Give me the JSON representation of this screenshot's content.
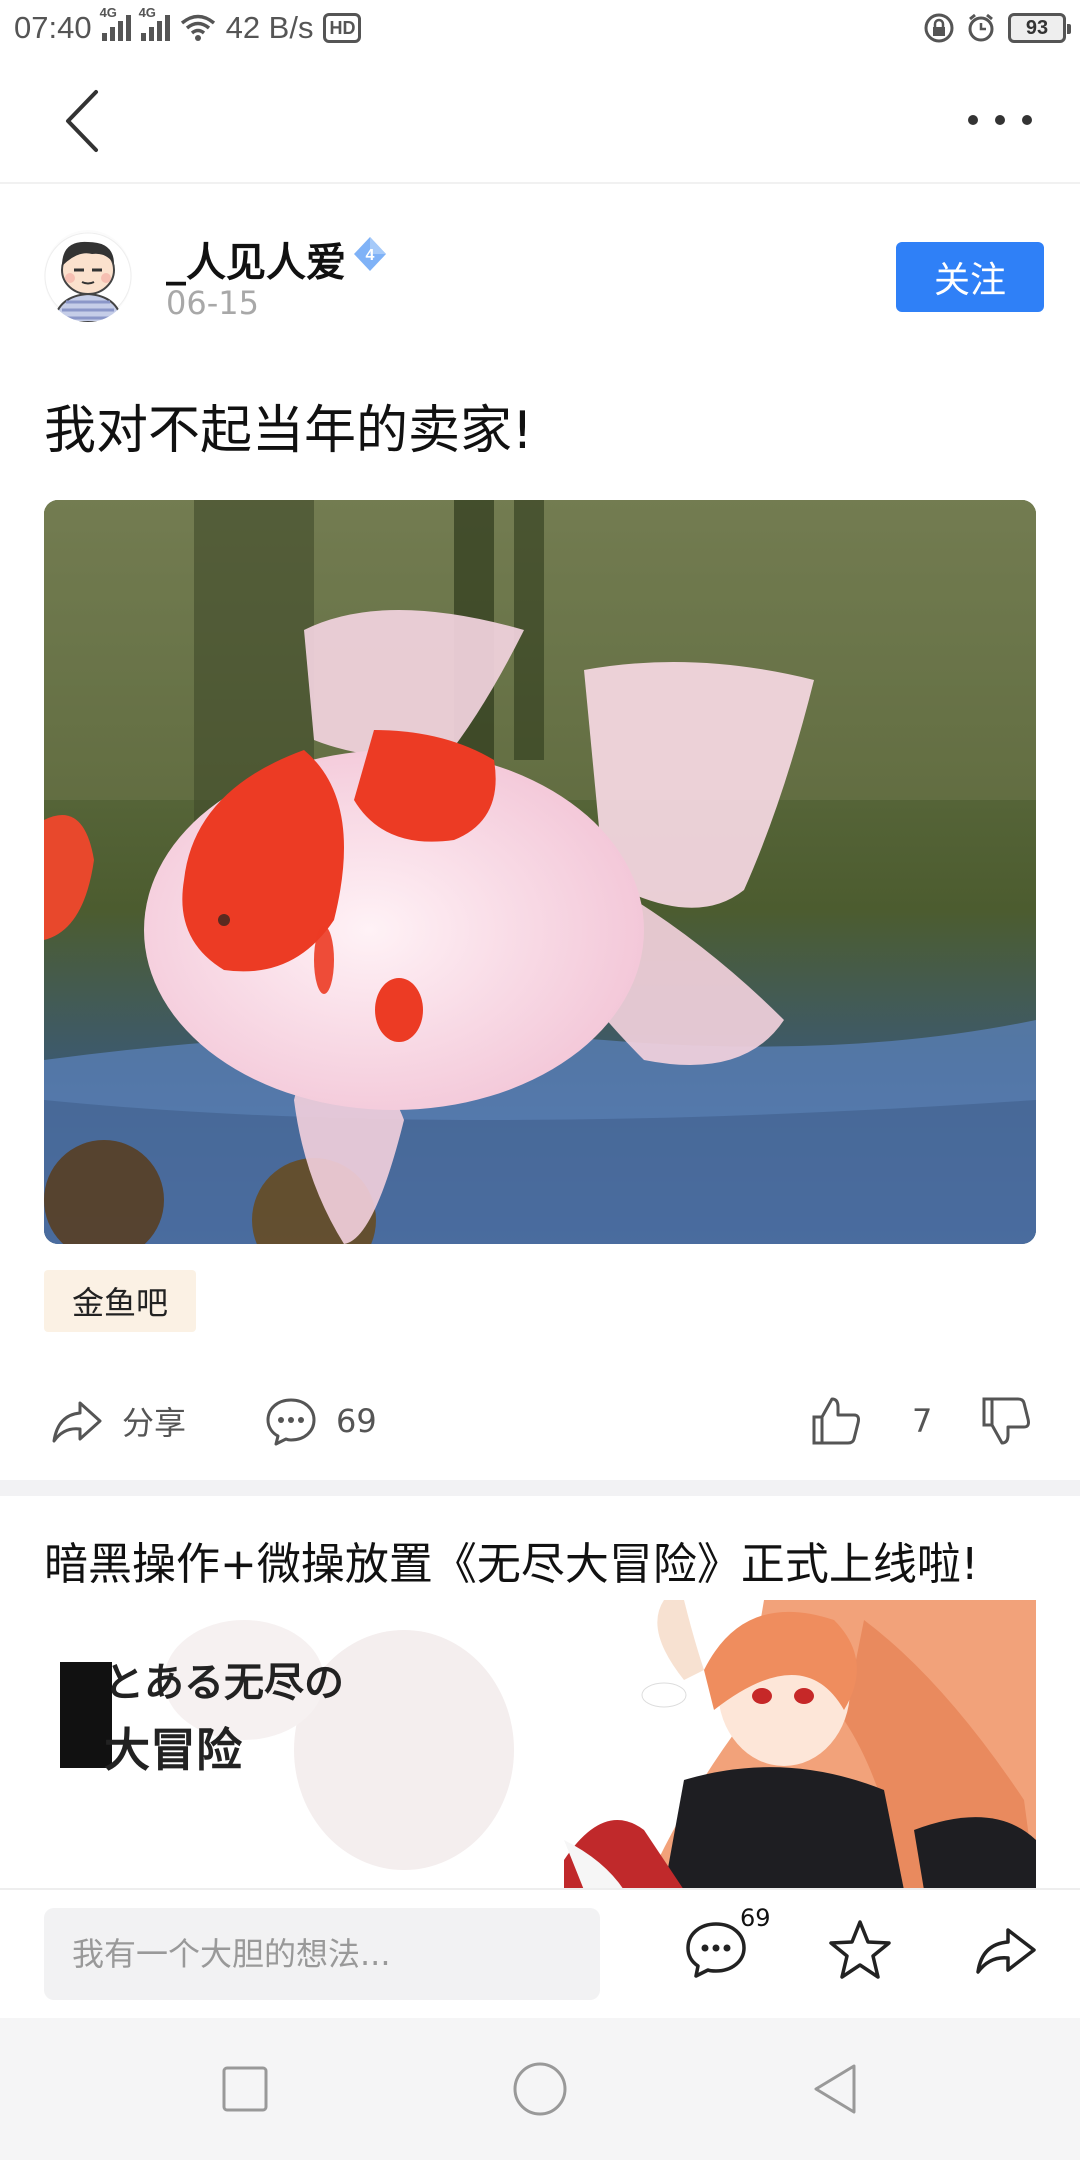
{
  "status_bar": {
    "time": "07:40",
    "net_tag_1": "4G",
    "net_tag_2": "4G",
    "speed": "42 B/s",
    "hd_label": "HD",
    "battery": "93",
    "icons": [
      "signal-icon",
      "wifi-icon",
      "hd-icon",
      "lock-icon",
      "alarm-icon",
      "battery-icon"
    ]
  },
  "nav": {
    "back_icon": "chevron-left-icon",
    "more_icon": "more-dots-icon"
  },
  "post": {
    "author": "_人见人爱",
    "level": "4",
    "date": "06-15",
    "follow_label": "关注",
    "title": "我对不起当年的卖家!",
    "forum_tag": "金鱼吧",
    "share_label": "分享",
    "comment_count": "69",
    "like_count": "7"
  },
  "ad": {
    "title": "暗黑操作+微操放置《无尽大冒险》正式上线啦!",
    "logo_line1": "とある无尽の",
    "logo_line2": "大冒险"
  },
  "bottom_bar": {
    "comment_placeholder": "我有一个大胆的想法...",
    "comment_count": "69"
  },
  "colors": {
    "accent": "#2f80f7",
    "tag_bg": "#fbf1e4",
    "divider": "#f2f2f4"
  }
}
